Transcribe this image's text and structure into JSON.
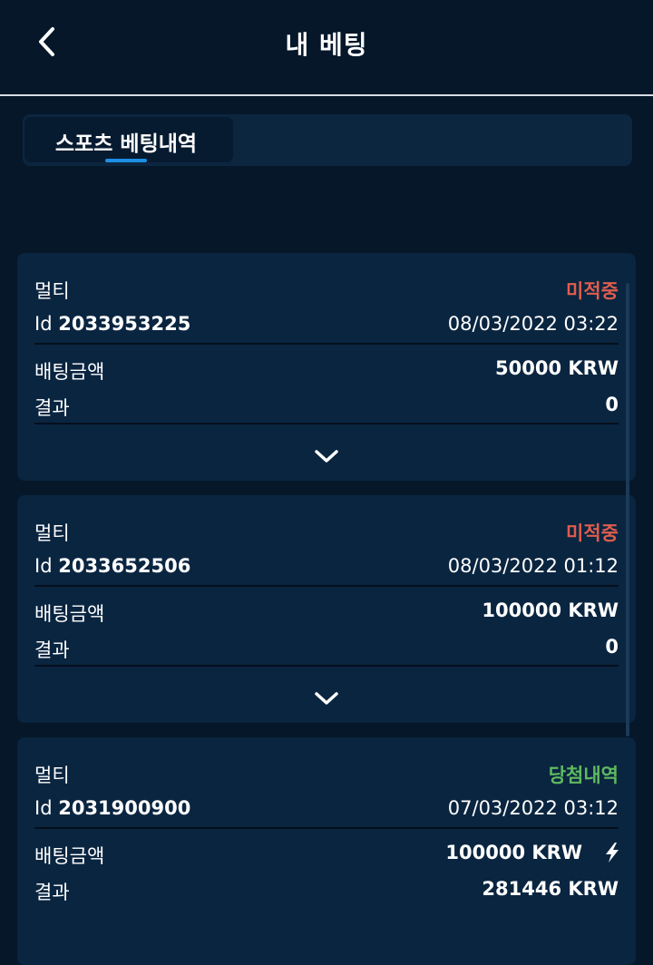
{
  "header": {
    "title": "내 베팅"
  },
  "tabs": [
    {
      "label": "스포츠 베팅내역"
    }
  ],
  "colors": {
    "background": "#051729",
    "card": "#0a2540",
    "accent_blue": "#1d8fe6",
    "status_pending": "#e05d4d",
    "status_won": "#5fb95f"
  },
  "bets": [
    {
      "type": "멀티",
      "status": "미적중",
      "id_label": "Id",
      "id_number": "2033953225",
      "datetime": "08/03/2022 03:22",
      "amount_label": "배팅금액",
      "amount": "50000 KRW",
      "result_label": "결과",
      "result": "0"
    },
    {
      "type": "멀티",
      "status": "미적중",
      "id_label": "Id",
      "id_number": "2033652506",
      "datetime": "08/03/2022 01:12",
      "amount_label": "배팅금액",
      "amount": "100000 KRW",
      "result_label": "결과",
      "result": "0"
    },
    {
      "type": "멀티",
      "status": "당첨내역",
      "id_label": "Id",
      "id_number": "2031900900",
      "datetime": "07/03/2022 03:12",
      "amount_label": "배팅금액",
      "amount": "100000 KRW",
      "result_label": "결과",
      "result": "281446 KRW"
    }
  ]
}
